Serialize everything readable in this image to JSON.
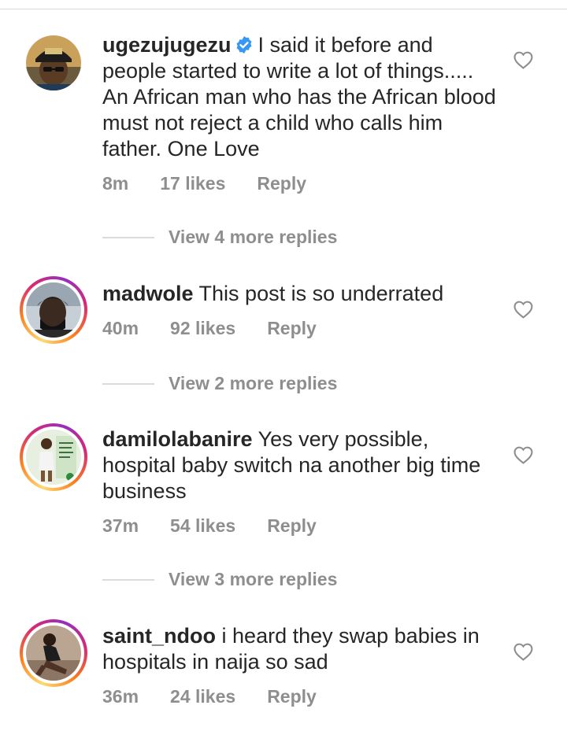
{
  "comments": [
    {
      "username": "ugezujugezu",
      "verified": true,
      "text": "I said it before and people started to write a lot of things..... An African man who has the African blood must not reject a child who calls him father. One Love",
      "time": "8m",
      "likes": "17 likes",
      "reply": "Reply",
      "view_replies": "View 4 more replies"
    },
    {
      "username": "madwole",
      "verified": false,
      "text": "This post is so underrated",
      "time": "40m",
      "likes": "92 likes",
      "reply": "Reply",
      "view_replies": "View 2 more replies"
    },
    {
      "username": "damilolabanire",
      "verified": false,
      "text": "Yes very possible, hospital baby switch na another big time business",
      "time": "37m",
      "likes": "54 likes",
      "reply": "Reply",
      "view_replies": "View 3 more replies"
    },
    {
      "username": "saint_ndoo",
      "verified": false,
      "text": "i heard they swap babies in hospitals in naija so sad",
      "time": "36m",
      "likes": "24 likes",
      "reply": "Reply"
    }
  ],
  "colors": {
    "text": "#262626",
    "muted": "#8e8e8e",
    "verified_blue": "#3897f0",
    "divider": "#dbdbdb"
  }
}
